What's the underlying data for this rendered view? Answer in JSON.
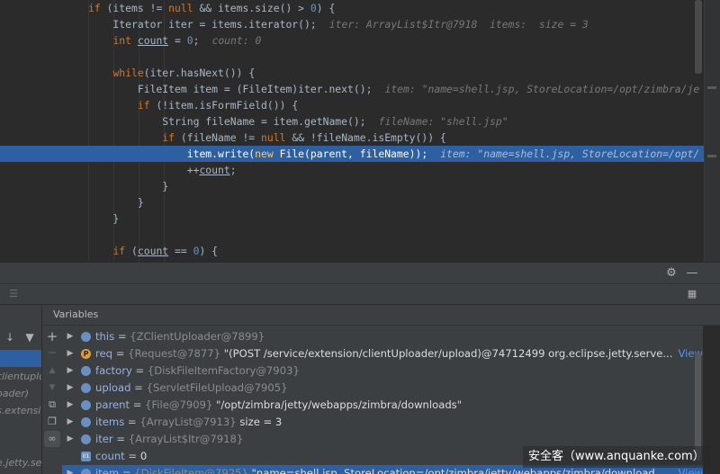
{
  "editor": {
    "lines": [
      {
        "html": "<span class=\"kw\">if</span> (items != <span class=\"kw\">null</span> &amp;&amp; items.size() &gt; <span class=\"num\">0</span>) {"
      },
      {
        "html": "    Iterator iter = items.iterator();<span class=\"hint\">iter: ArrayList$Itr@7918  items:  size = 3</span>"
      },
      {
        "html": "    <span class=\"kw\">int</span> <span class=\"u\">count</span> = <span class=\"num\">0</span>;<span class=\"hint\">count: 0</span>"
      },
      {
        "html": ""
      },
      {
        "html": "    <span class=\"kw\">while</span>(iter.hasNext()) {"
      },
      {
        "html": "        FileItem item = (FileItem)iter.next();<span class=\"hint\">item: \"name=shell.jsp, StoreLocation=/opt/zimbra/je</span>"
      },
      {
        "html": "        <span class=\"kw\">if</span> (!item.isFormField()) {"
      },
      {
        "html": "            String fileName = item.getName();<span class=\"hint\">fileName: \"shell.jsp\"</span>"
      },
      {
        "html": "            <span class=\"kw\">if</span> (fileName != <span class=\"kw\">null</span> &amp;&amp; !fileName.isEmpty()) {"
      },
      {
        "html": "                item.write(<span class=\"kw\">new</span> File(parent, fileName));<span class=\"hint\">item: \"name=shell.jsp, StoreLocation=/opt/</span>"
      },
      {
        "html": "                ++<span class=\"u\">count</span>;"
      },
      {
        "html": "            }"
      },
      {
        "html": "        }"
      },
      {
        "html": "    }"
      },
      {
        "html": ""
      },
      {
        "html": "    <span class=\"kw\">if</span> (<span class=\"u\">count</span> == <span class=\"num\">0</span>) {"
      }
    ],
    "exec_line_index": 9
  },
  "debug": {
    "variables_title": "Variables",
    "frames": [
      "clientuplo",
      "oader)",
      "s.extensi",
      "e.jetty.se"
    ],
    "variables": [
      {
        "icon": "expand",
        "name": "this",
        "type": "{ZClientUploader@7899}",
        "value": "",
        "link": ""
      },
      {
        "icon": "p",
        "name": "req",
        "type": "{Request@7877}",
        "value": "\"(POST /service/extension/clientUploader/upload)@74712499 org.eclipse.jetty.serve...",
        "link": "View"
      },
      {
        "icon": "expand",
        "name": "factory",
        "type": "{DiskFileItemFactory@7903}",
        "value": "",
        "link": ""
      },
      {
        "icon": "expand",
        "name": "upload",
        "type": "{ServletFileUpload@7905}",
        "value": "",
        "link": ""
      },
      {
        "icon": "expand",
        "name": "parent",
        "type": "{File@7909}",
        "value": "\"/opt/zimbra/jetty/webapps/zimbra/downloads\"",
        "link": ""
      },
      {
        "icon": "expand",
        "name": "items",
        "type": "{ArrayList@7913}",
        "value": "size = 3",
        "link": ""
      },
      {
        "icon": "expand",
        "name": "iter",
        "type": "{ArrayList$Itr@7918}",
        "value": "",
        "link": ""
      },
      {
        "icon": "const",
        "name": "count",
        "type": "",
        "value": "0",
        "link": ""
      },
      {
        "icon": "expand",
        "name": "item",
        "type": "{DiskFileItem@7925}",
        "value": "\"name=shell.jsp, StoreLocation=/opt/zimbra/jetty/webapps/zimbra/download...",
        "link": "View"
      }
    ]
  },
  "watermark": "安全客（www.anquanke.com）"
}
